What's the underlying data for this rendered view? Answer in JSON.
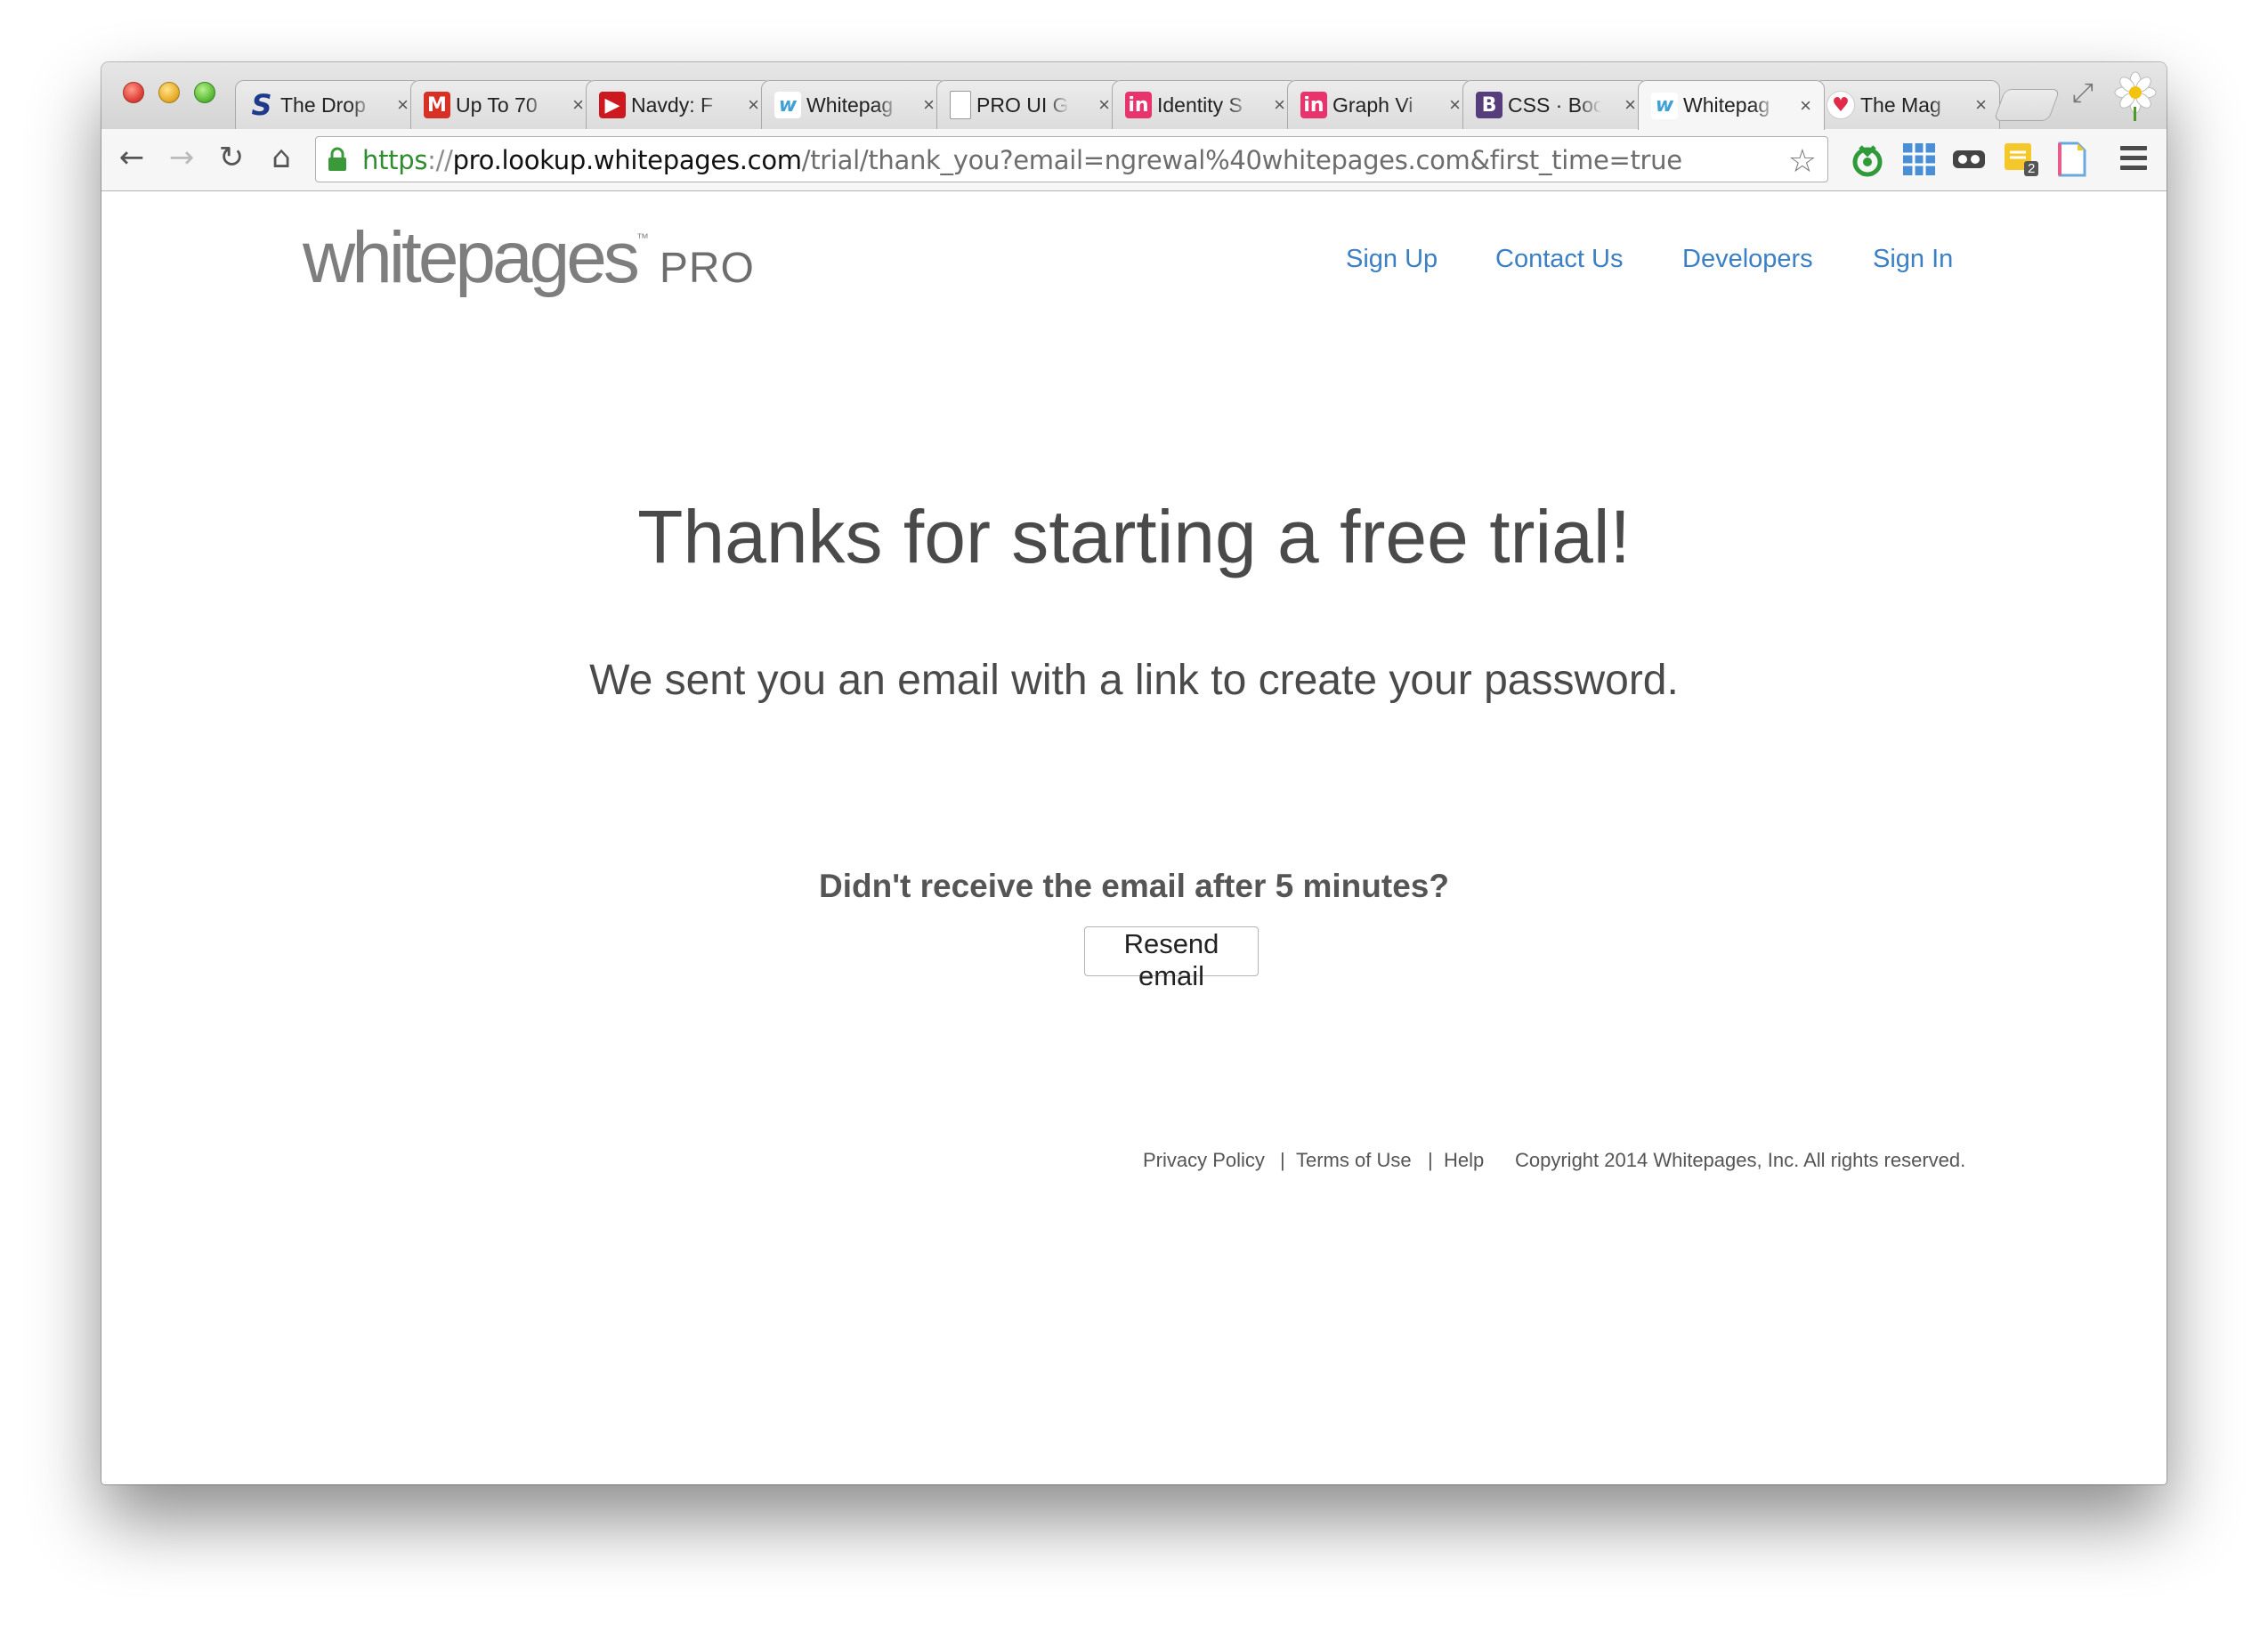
{
  "browser": {
    "tabs": [
      {
        "title": "The Drop",
        "favicon": "S",
        "favicon_color": "#1e3a8a",
        "icon_name": "simplenote-s-icon"
      },
      {
        "title": "Up To 70",
        "favicon": "M",
        "favicon_color": "#d93025",
        "icon_name": "gmail-icon"
      },
      {
        "title": "Navdy: F",
        "favicon": "▶",
        "favicon_color": "#cc181e",
        "icon_name": "youtube-icon"
      },
      {
        "title": "Whitepag",
        "favicon": "w",
        "favicon_color": "#3fa0d6",
        "icon_name": "whitepages-icon"
      },
      {
        "title": "PRO UI G",
        "favicon": "",
        "favicon_color": "#ffffff",
        "icon_name": "document-icon"
      },
      {
        "title": "Identity S",
        "favicon": "in",
        "favicon_color": "#e8336d",
        "icon_name": "invision-icon"
      },
      {
        "title": "Graph Vi",
        "favicon": "in",
        "favicon_color": "#e8336d",
        "icon_name": "invision-icon"
      },
      {
        "title": "CSS · Boo",
        "favicon": "B",
        "favicon_color": "#563d7c",
        "icon_name": "bootstrap-icon"
      },
      {
        "title": "Whitepag",
        "favicon": "w",
        "favicon_color": "#3fa0d6",
        "icon_name": "whitepages-icon",
        "active": true
      },
      {
        "title": "The Mag",
        "favicon": "♥",
        "favicon_color": "#e02b4a",
        "icon_name": "heart-icon"
      }
    ],
    "tab_close": "×",
    "url": {
      "scheme": "https",
      "separator": "://",
      "host": "pro.lookup.whitepages.com",
      "path": "/trial/thank_you?email=ngrewal%40whitepages.com&first_time=true"
    },
    "extension_badge": "2"
  },
  "site": {
    "logo_word": "whitepages",
    "logo_tm": "™",
    "logo_suffix": "PRO",
    "nav": [
      "Sign Up",
      "Contact Us",
      "Developers",
      "Sign In"
    ]
  },
  "main": {
    "headline": "Thanks for starting a free trial!",
    "subline": "We sent you an email with a link to create your password.",
    "question": "Didn't receive the email after 5 minutes?",
    "resend_label": "Resend email"
  },
  "footer": {
    "privacy": "Privacy Policy",
    "sep": "|",
    "terms": "Terms of Use",
    "help": "Help",
    "copyright": "Copyright 2014 Whitepages, Inc. All rights reserved."
  },
  "colors": {
    "link": "#3b7fc4",
    "text": "#4a4a4a",
    "url_scheme": "#2f8d2f"
  }
}
